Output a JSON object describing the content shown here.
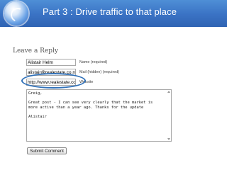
{
  "slide": {
    "title": "Part 3 : Drive traffic to that place"
  },
  "form": {
    "heading": "Leave a Reply",
    "name": {
      "value": "Alistair Helm",
      "label": "Name (required)"
    },
    "email": {
      "value": "alistair@realestate.co.nz",
      "label": "Mail (hidden) (required)"
    },
    "website": {
      "value": "http://www.realestate.co.nz/",
      "label": "Website"
    },
    "comment": "Greig,\n\nGreat post - I can see very clearly that the market is\nmore active than a year ago. Thanks for the update\n\nAlistair",
    "submit_label": "Submit Comment"
  },
  "colors": {
    "header": "#3a72c4",
    "highlight": "#2f70b8"
  }
}
